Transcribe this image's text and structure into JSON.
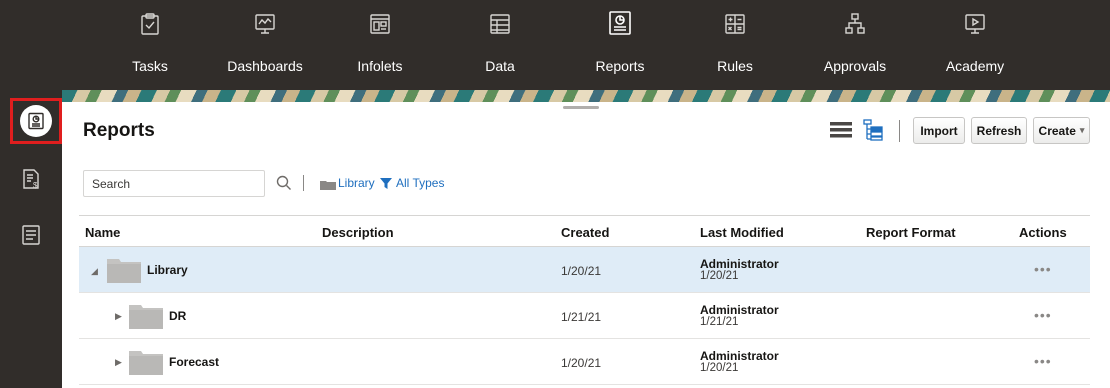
{
  "nav": {
    "items": [
      {
        "label": "Tasks",
        "icon": "tasks-icon"
      },
      {
        "label": "Dashboards",
        "icon": "dashboard-icon"
      },
      {
        "label": "Infolets",
        "icon": "infolets-icon"
      },
      {
        "label": "Data",
        "icon": "data-icon"
      },
      {
        "label": "Reports",
        "icon": "reports-icon",
        "active": true
      },
      {
        "label": "Rules",
        "icon": "rules-icon"
      },
      {
        "label": "Approvals",
        "icon": "approvals-icon"
      },
      {
        "label": "Academy",
        "icon": "academy-icon"
      }
    ]
  },
  "rail": {
    "items": [
      {
        "icon": "reports-icon",
        "active": true
      },
      {
        "icon": "financial-report-icon"
      },
      {
        "icon": "document-icon"
      }
    ]
  },
  "page": {
    "title": "Reports"
  },
  "toolbar": {
    "import_label": "Import",
    "refresh_label": "Refresh",
    "create_label": "Create"
  },
  "search": {
    "placeholder": "Search"
  },
  "filters": {
    "library_label": "Library",
    "types_label": "All Types"
  },
  "table": {
    "columns": [
      "Name",
      "Description",
      "Created",
      "Last Modified",
      "Report Format",
      "Actions"
    ],
    "rows": [
      {
        "name": "Library",
        "created": "1/20/21",
        "modified_by": "Administrator",
        "modified_date": "1/20/21",
        "actions": "•••",
        "expanded": true,
        "selected": true
      },
      {
        "name": "DR",
        "created": "1/21/21",
        "modified_by": "Administrator",
        "modified_date": "1/21/21",
        "actions": "•••",
        "expanded": false
      },
      {
        "name": "Forecast",
        "created": "1/20/21",
        "modified_by": "Administrator",
        "modified_date": "1/20/21",
        "actions": "•••",
        "expanded": false
      }
    ]
  },
  "colors": {
    "nav_bg": "#312d2a",
    "selected_row": "#dfecf7",
    "link": "#1f6fbf",
    "highlight_border": "#e01e1e"
  }
}
